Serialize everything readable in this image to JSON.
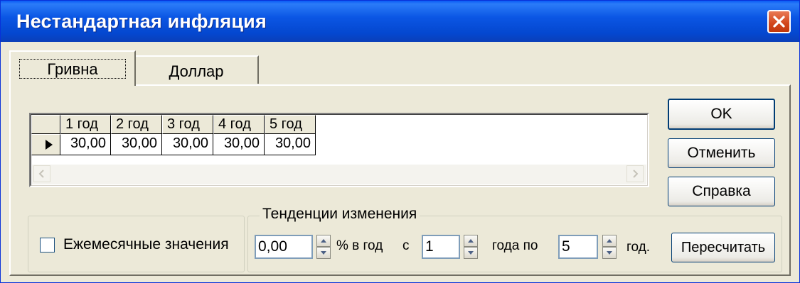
{
  "window": {
    "title": "Нестандартная инфляция"
  },
  "tabs": [
    {
      "label": "Гривна",
      "active": true
    },
    {
      "label": "Доллар",
      "active": false
    }
  ],
  "grid": {
    "columns": [
      "1 год",
      "2 год",
      "3 год",
      "4 год",
      "5 год"
    ],
    "rows": [
      [
        "30,00",
        "30,00",
        "30,00",
        "30,00",
        "30,00"
      ]
    ]
  },
  "buttons": {
    "ok": "OK",
    "cancel": "Отменить",
    "help": "Справка",
    "recalc": "Пересчитать"
  },
  "monthly": {
    "label": "Ежемесячные значения",
    "checked": false
  },
  "trends": {
    "legend": "Тенденции изменения",
    "rate_value": "0,00",
    "rate_suffix": "% в год",
    "from_label": "с",
    "from_value": "1",
    "to_prefix": "года по",
    "to_value": "5",
    "to_suffix": "год."
  },
  "icons": {
    "close": "close-icon",
    "row_indicator": "row-pointer-icon",
    "scroll_left": "arrow-left-icon",
    "scroll_right": "arrow-right-icon",
    "spin": "spin-up-down-icon"
  }
}
